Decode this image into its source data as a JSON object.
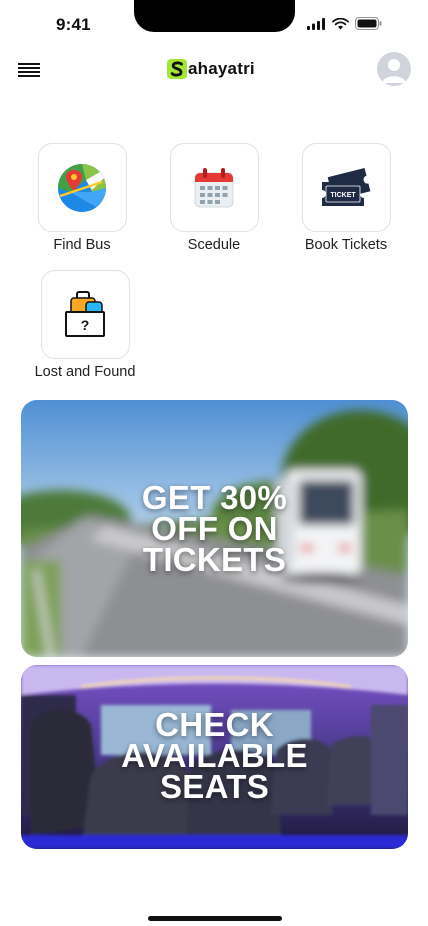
{
  "status_bar": {
    "time": "9:41"
  },
  "header": {
    "brand_letter": "S",
    "brand_name": "ahayatri"
  },
  "tiles": [
    {
      "label": "Find Bus",
      "icon": "map-pin-icon"
    },
    {
      "label": "Scedule",
      "icon": "calendar-icon"
    },
    {
      "label": "Book Tickets",
      "icon": "ticket-icon"
    },
    {
      "label": "Lost and Found",
      "icon": "lost-luggage-icon"
    }
  ],
  "banners": [
    {
      "lines": [
        "GET 30%",
        "OFF ON",
        "TICKETS"
      ]
    },
    {
      "lines": [
        "CHECK",
        "AVAILABLE",
        "SEATS"
      ]
    }
  ],
  "colors": {
    "brand_accent": "#a3e635",
    "ticket_navy": "#1f2a44"
  }
}
